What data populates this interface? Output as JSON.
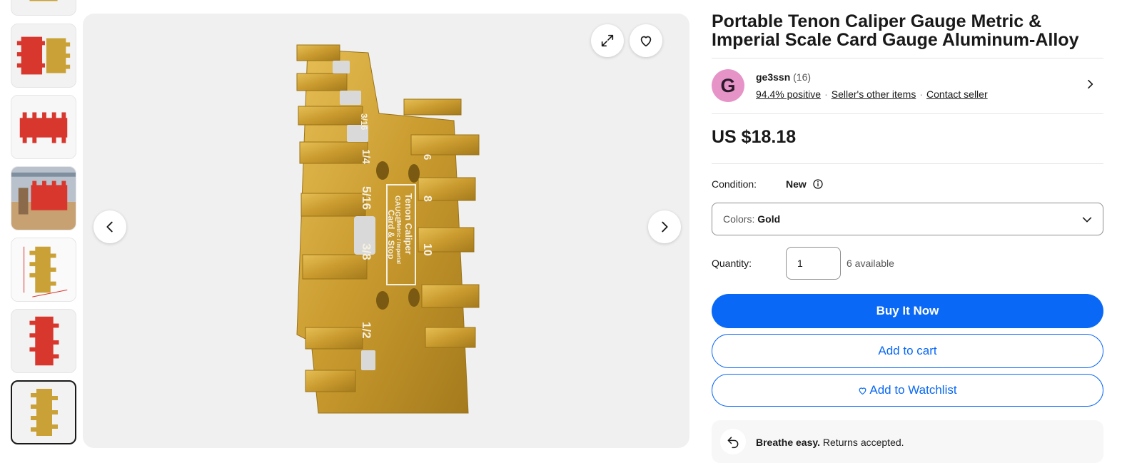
{
  "gallery": {
    "thumbnails": [
      {
        "desc": "gauge-partial-top",
        "active": false
      },
      {
        "desc": "gauge-red-and-gold",
        "active": false
      },
      {
        "desc": "gauge-red-side",
        "active": false
      },
      {
        "desc": "gauge-red-on-wood",
        "active": false
      },
      {
        "desc": "gauge-gold-dimensions",
        "active": false
      },
      {
        "desc": "gauge-red-upright",
        "active": false
      },
      {
        "desc": "gauge-gold-front",
        "active": true
      }
    ],
    "main_image_text": {
      "brand": "GAUGE",
      "name": "Tenon Caliper",
      "sub1": "Metric / Imperial",
      "sub2": "Card & Stop",
      "frac_516": "5/16",
      "frac_38": "3/8",
      "frac_12": "1/2",
      "frac_14": "1/4",
      "frac_316": "3/16",
      "num_10": "10",
      "num_8": "8",
      "num_6": "6"
    }
  },
  "product": {
    "title": "Portable Tenon Caliper Gauge Metric & Imperial Scale Card Gauge Aluminum-Alloy",
    "seller": {
      "initial": "G",
      "name": "ge3ssn",
      "feedback_count": "(16)",
      "positive": "94.4% positive",
      "other_items": "Seller's other items",
      "contact": "Contact seller"
    },
    "price": "US $18.18",
    "condition_label": "Condition:",
    "condition_value": "New",
    "colors_label": "Colors:",
    "colors_value": "Gold",
    "quantity_label": "Quantity:",
    "quantity_value": "1",
    "available": "6 available",
    "buy_now": "Buy It Now",
    "add_to_cart": "Add to cart",
    "add_to_watchlist": "Add to Watchlist",
    "returns_bold": "Breathe easy.",
    "returns_text": "Returns accepted."
  },
  "colors": {
    "primary_blue": "#0968f6",
    "gold": "#c9a136",
    "red": "#d8372e"
  }
}
